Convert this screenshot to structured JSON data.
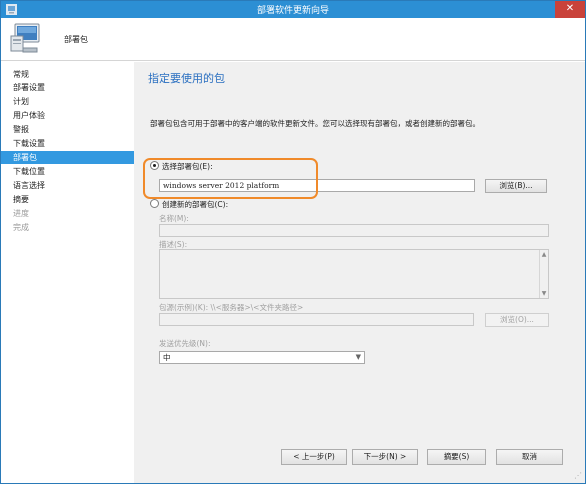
{
  "window": {
    "title": "部署软件更新向导",
    "close_label": "✕"
  },
  "header": {
    "title": "部署包"
  },
  "sidebar": {
    "items": [
      {
        "label": "常规",
        "state": "normal"
      },
      {
        "label": "部署设置",
        "state": "normal"
      },
      {
        "label": "计划",
        "state": "normal"
      },
      {
        "label": "用户体验",
        "state": "normal"
      },
      {
        "label": "警报",
        "state": "normal"
      },
      {
        "label": "下载设置",
        "state": "normal"
      },
      {
        "label": "部署包",
        "state": "active"
      },
      {
        "label": "下载位置",
        "state": "normal"
      },
      {
        "label": "语言选择",
        "state": "normal"
      },
      {
        "label": "摘要",
        "state": "normal"
      },
      {
        "label": "进度",
        "state": "disabled"
      },
      {
        "label": "完成",
        "state": "disabled"
      }
    ]
  },
  "main": {
    "heading": "指定要使用的包",
    "description": "部署包包含可用于部署中的客户端的软件更新文件。您可以选择现有部署包，或者创建新的部署包。",
    "select_existing": {
      "label": "选择部署包(E):",
      "checked": true,
      "value": "windows server 2012 platform",
      "browse_label": "浏览(B)..."
    },
    "create_new": {
      "label": "创建新的部署包(C):",
      "checked": false,
      "name_label": "名称(M):",
      "name_value": "",
      "desc_label": "描述(S):",
      "desc_value": "",
      "source_label": "包源(示例)(K):  \\\\<服务器>\\<文件夹路径>",
      "source_value": "",
      "browse_label": "浏览(O)...",
      "priority_label": "发送优先级(N):",
      "priority_value": "中"
    }
  },
  "footer": {
    "prev_label": "< 上一步(P)",
    "next_label": "下一步(N) >",
    "summary_label": "摘要(S)",
    "cancel_label": "取消"
  },
  "colors": {
    "titlebar": "#2c8fd4",
    "active_item": "#3399e0",
    "heading": "#2a6fc0",
    "highlight": "#f08a2a"
  }
}
